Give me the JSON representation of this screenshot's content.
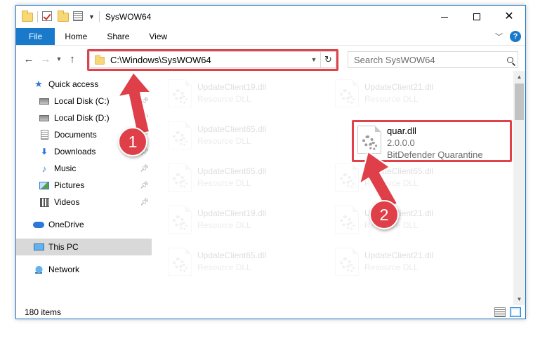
{
  "window": {
    "title": "SysWOW64"
  },
  "ribbon": {
    "tabs": [
      "File",
      "Home",
      "Share",
      "View"
    ],
    "help": "?"
  },
  "address": {
    "path": "C:\\Windows\\SysWOW64"
  },
  "search": {
    "placeholder": "Search SysWOW64"
  },
  "sidebar": {
    "items": [
      {
        "label": "Quick access",
        "icon": "star-icon",
        "pinned": false
      },
      {
        "label": "Local Disk (C:)",
        "icon": "drive-icon",
        "pinned": true
      },
      {
        "label": "Local Disk (D:)",
        "icon": "drive-icon",
        "pinned": true
      },
      {
        "label": "Documents",
        "icon": "documents-icon",
        "pinned": true
      },
      {
        "label": "Downloads",
        "icon": "downloads-icon",
        "pinned": true
      },
      {
        "label": "Music",
        "icon": "music-icon",
        "pinned": true
      },
      {
        "label": "Pictures",
        "icon": "pictures-icon",
        "pinned": true
      },
      {
        "label": "Videos",
        "icon": "videos-icon",
        "pinned": true
      },
      {
        "label": "OneDrive",
        "icon": "onedrive-icon",
        "pinned": false
      },
      {
        "label": "This PC",
        "icon": "this-pc-icon",
        "pinned": false,
        "selected": true
      },
      {
        "label": "Network",
        "icon": "network-icon",
        "pinned": false
      }
    ]
  },
  "files": [
    {
      "name": "UpdateClient19.dll",
      "type": "Resource DLL"
    },
    {
      "name": "UpdateClient21.dll",
      "type": "Resource DLL"
    },
    {
      "name": "UpdateClient65.dll",
      "type": "Resource DLL"
    },
    {
      "name": "quar.dll",
      "version": "2.0.0.0",
      "description": "BitDefender Quarantine"
    },
    {
      "name": "UpdateClient65.dll",
      "type": "Resource DLL"
    },
    {
      "name": "UpdateClient65.dll",
      "type": "Resource DLL"
    },
    {
      "name": "UpdateClient19.dll",
      "type": "Resource DLL"
    },
    {
      "name": "UpdateClient21.dll",
      "type": "Resource DLL"
    },
    {
      "name": "UpdateClient65.dll",
      "type": "Resource DLL"
    },
    {
      "name": "UpdateClient21.dll",
      "type": "Resource DLL"
    }
  ],
  "status": {
    "item_count": "180 items"
  },
  "callouts": {
    "step1": "1",
    "step2": "2"
  },
  "colors": {
    "accent": "#1979ca",
    "callout": "#df3f48"
  }
}
